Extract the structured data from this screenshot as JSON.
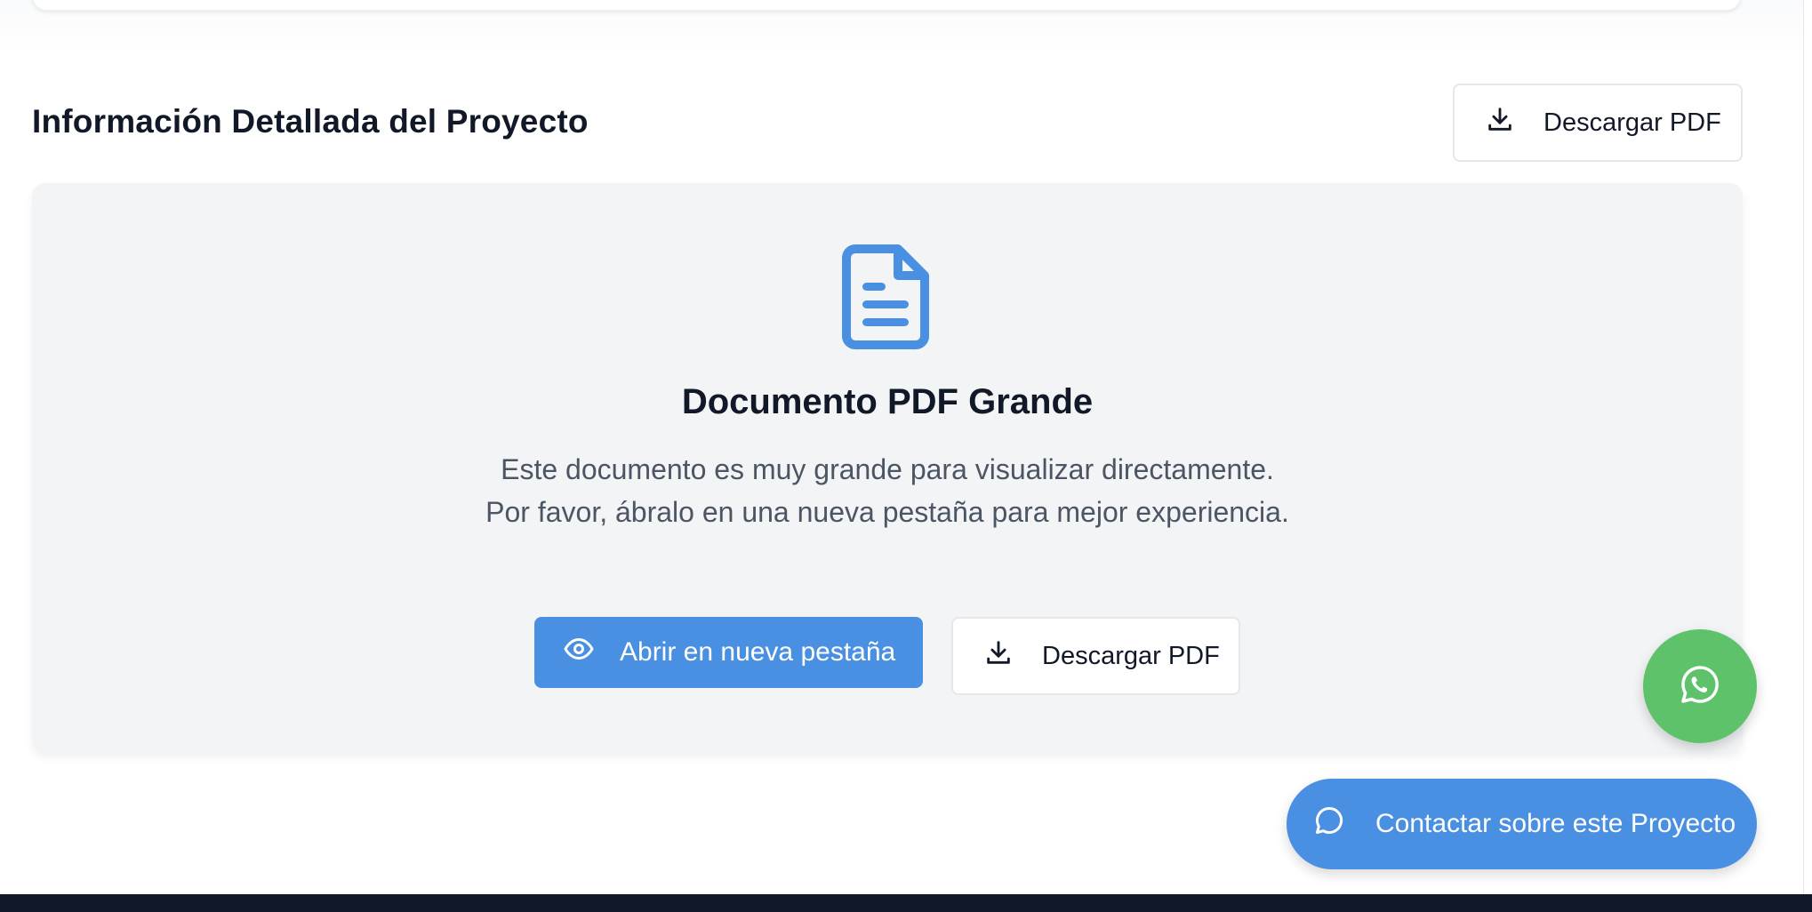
{
  "section": {
    "title": "Información Detallada del Proyecto",
    "download_label": "Descargar PDF"
  },
  "pdf_notice": {
    "icon": "document-icon",
    "title": "Documento PDF Grande",
    "description": "Este documento es muy grande para visualizar directamente. Por favor, ábralo en una nueva pestaña para mejor experiencia.",
    "open_label": "Abrir en nueva pestaña",
    "download_label": "Descargar PDF"
  },
  "floating": {
    "whatsapp_icon": "whatsapp-icon",
    "contact_label": "Contactar sobre este Proyecto"
  },
  "colors": {
    "primary": "#4a90e2",
    "whatsapp": "#5ec26a",
    "panel_bg": "#f3f4f6",
    "text_dark": "#111827",
    "text_muted": "#4b5563"
  }
}
